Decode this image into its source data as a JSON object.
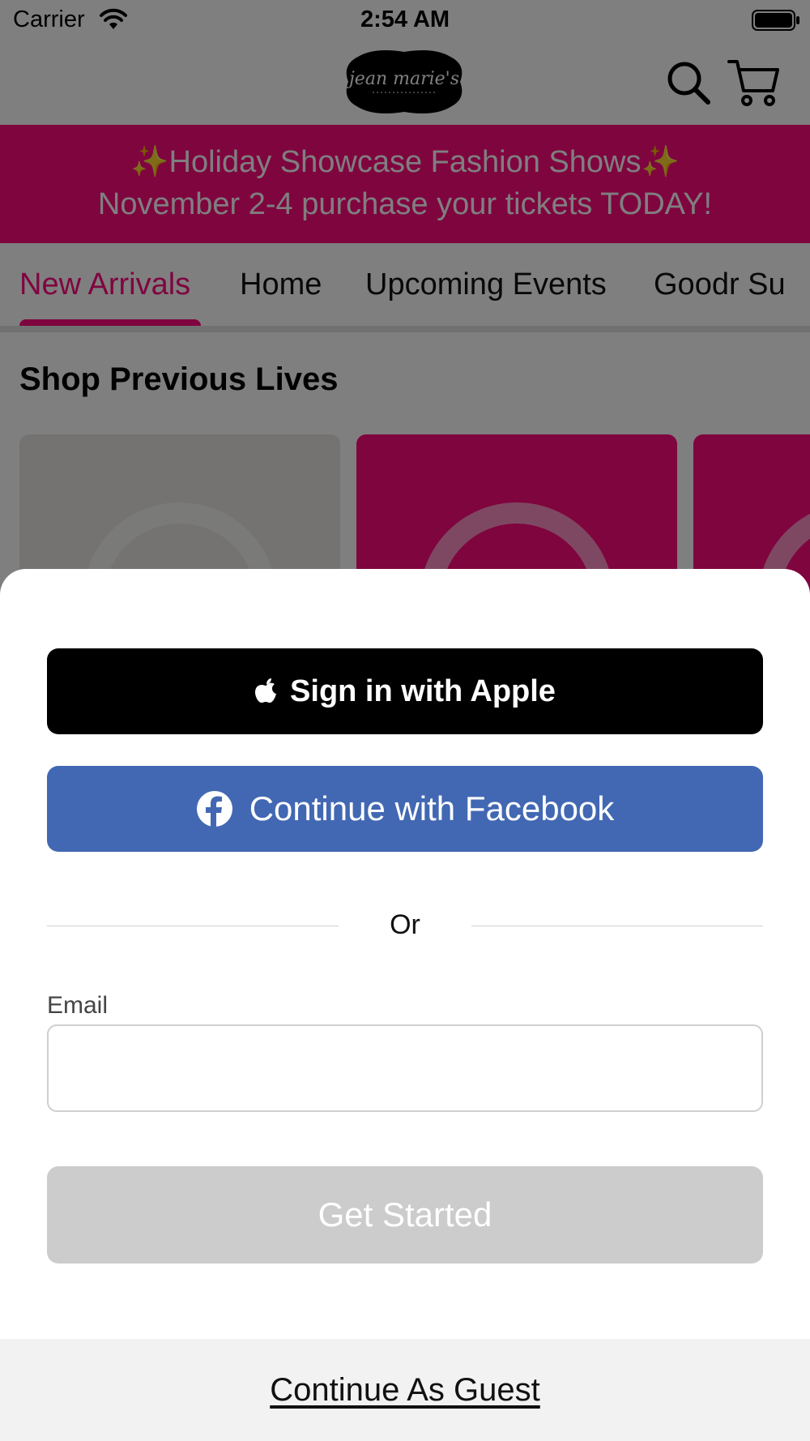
{
  "status_bar": {
    "carrier": "Carrier",
    "time": "2:54 AM"
  },
  "header": {
    "logo_icon": "jean-maries-logo",
    "search_icon": "search-icon",
    "cart_icon": "cart-icon"
  },
  "promo": {
    "line1": "✨Holiday Showcase Fashion Shows✨",
    "line2": "November 2-4 purchase your tickets TODAY!",
    "color": "#ff0a7f"
  },
  "tabs": [
    {
      "label": "New Arrivals",
      "active": true
    },
    {
      "label": "Home",
      "active": false
    },
    {
      "label": "Upcoming Events",
      "active": false
    },
    {
      "label": "Goodr Su",
      "active": false
    }
  ],
  "section": {
    "title": "Shop Previous Lives"
  },
  "sheet": {
    "apple_button": "Sign in with Apple",
    "facebook_button": "Continue with Facebook",
    "or_text": "Or",
    "email_label": "Email",
    "email_value": "",
    "email_placeholder": "",
    "get_started": "Get Started",
    "guest_link": "Continue As Guest",
    "facebook_color": "#4268b3"
  }
}
